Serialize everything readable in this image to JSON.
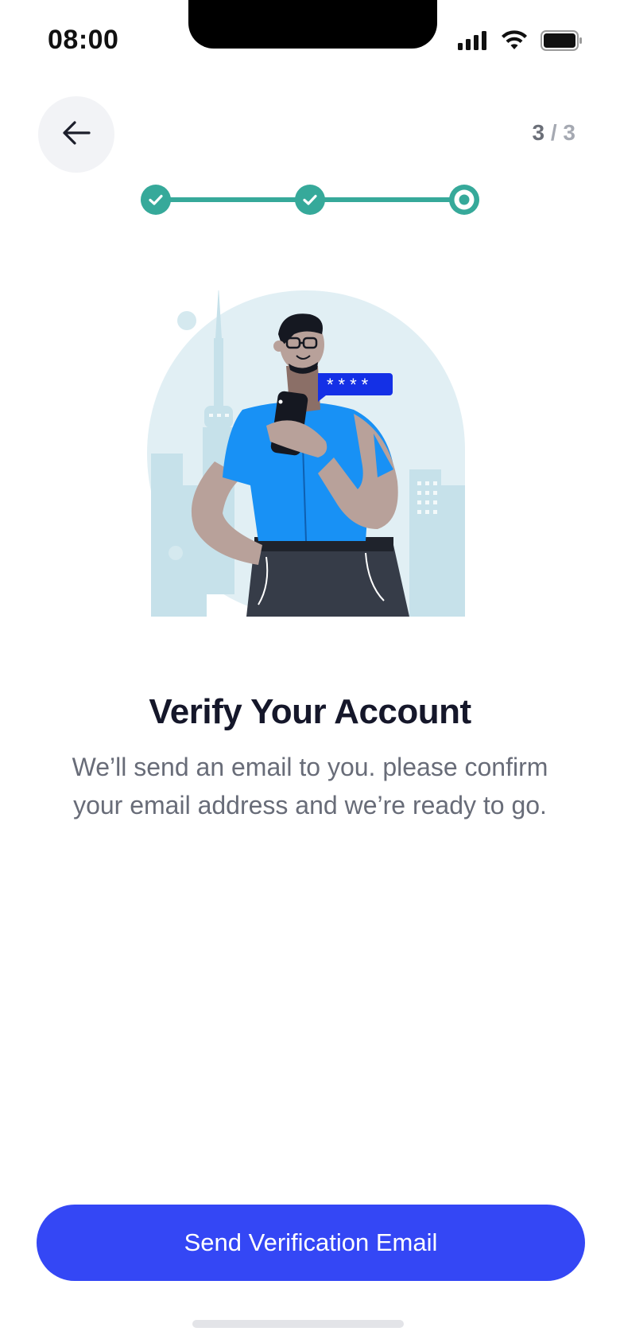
{
  "status_bar": {
    "time": "08:00"
  },
  "header": {
    "back_icon": "arrow-left-icon",
    "step_current": "3",
    "step_separator": "/",
    "step_total": "3"
  },
  "progress": {
    "steps": [
      {
        "state": "completed",
        "icon": "check-icon"
      },
      {
        "state": "completed",
        "icon": "check-icon"
      },
      {
        "state": "current",
        "icon": "ring-icon"
      }
    ],
    "color": "#36a99a"
  },
  "illustration": {
    "bubble_text": "****"
  },
  "content": {
    "title": "Verify Your Account",
    "subtitle": "We’ll send an email to you. please confirm your email address and we’re ready to go."
  },
  "cta": {
    "label": "Send Verification Email",
    "color": "#3447f5"
  }
}
